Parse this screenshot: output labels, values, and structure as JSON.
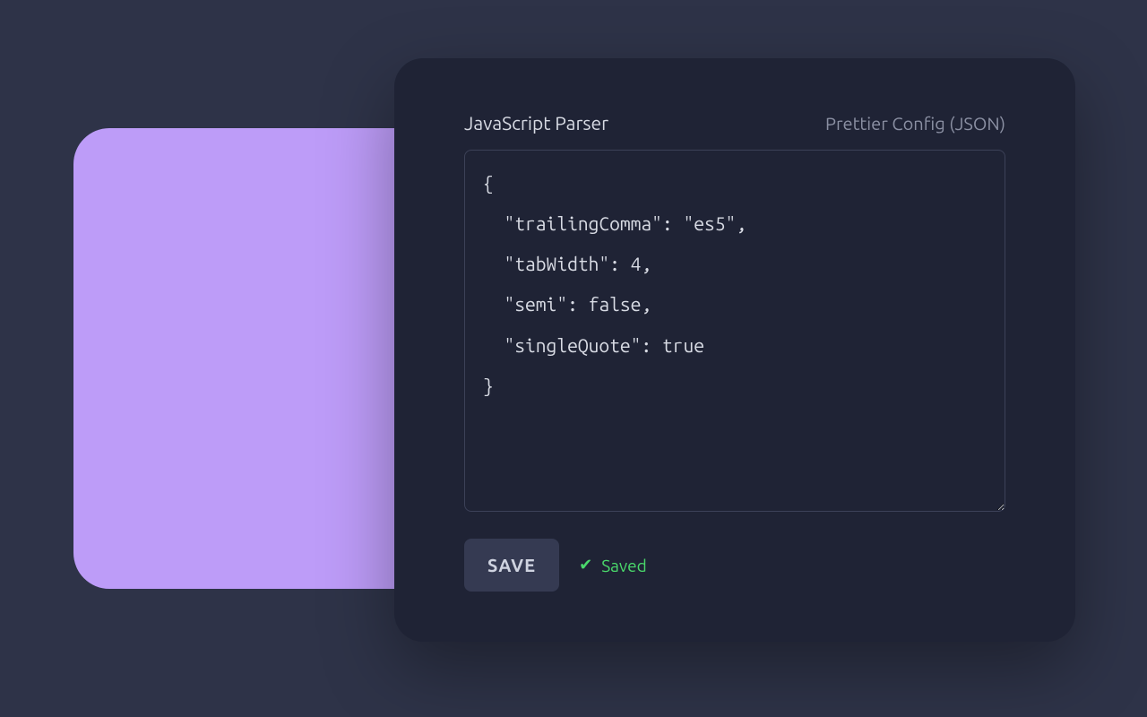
{
  "editor": {
    "title": "JavaScript Parser",
    "subtitle": "Prettier Config (JSON)",
    "content": "{\n  \"trailingComma\": \"es5\",\n  \"tabWidth\": 4,\n  \"semi\": false,\n  \"singleQuote\": true\n}",
    "save_label": "SAVE",
    "status_icon": "✔",
    "status_text": "Saved"
  }
}
